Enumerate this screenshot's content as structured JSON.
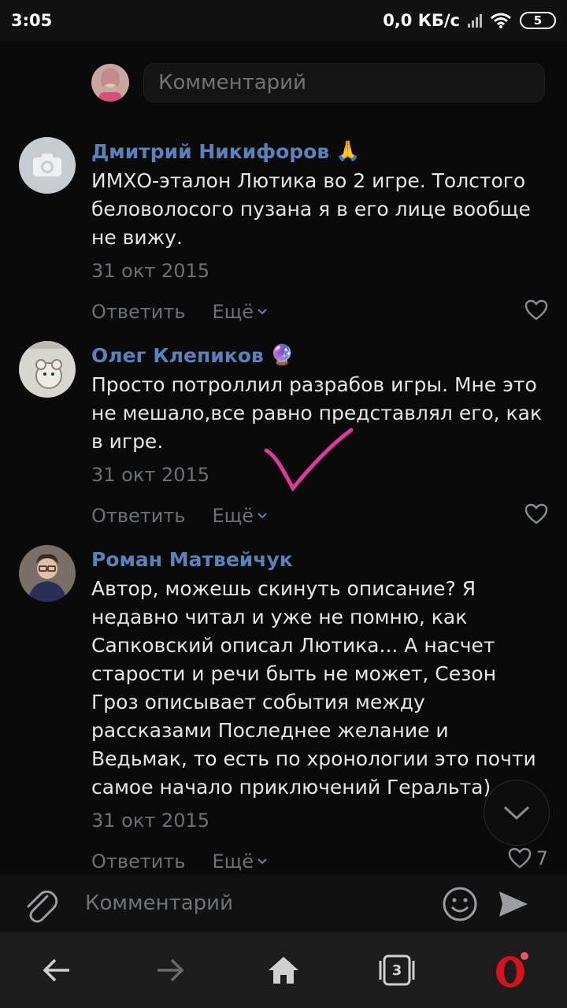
{
  "status_bar": {
    "time": "3:05",
    "speed": "0,0 КБ/с",
    "battery": "5"
  },
  "top_comment_input": {
    "placeholder": "Комментарий"
  },
  "comments": [
    {
      "author": "Дмитрий Никифоров",
      "emoji": "🙏",
      "text": "ИМХО-эталон Лютика во 2 игре. Толстого беловолосого пузана я в его лице вообще не вижу.",
      "date": "31 окт 2015",
      "reply_label": "Ответить",
      "more_label": "Ещё",
      "likes": ""
    },
    {
      "author": "Олег Клепиков",
      "emoji": "🔮",
      "text": "Просто потроллил разрабов игры. Мне это не мешало,все равно представлял его, как в игре.",
      "date": "31 окт 2015",
      "reply_label": "Ответить",
      "more_label": "Ещё",
      "likes": ""
    },
    {
      "author": "Роман Матвейчук",
      "emoji": "",
      "text": "Автор, можешь скинуть описание? Я недавно читал и уже не помню, как Сапковский описал Лютика... А насчет старости и речи быть не может, Сезон Гроз описывает события между рассказами Последнее желание и Ведьмак, то есть по хронологии это почти самое начало приключений Геральта)",
      "date": "31 окт 2015",
      "reply_label": "Ответить",
      "more_label": "Ещё",
      "likes": "7"
    }
  ],
  "compose": {
    "placeholder": "Комментарий"
  },
  "browser_nav": {
    "tabs_count": "3"
  },
  "colors": {
    "link": "#5a82b8",
    "annotation": "#e0399e",
    "opera": "#d6121e"
  }
}
